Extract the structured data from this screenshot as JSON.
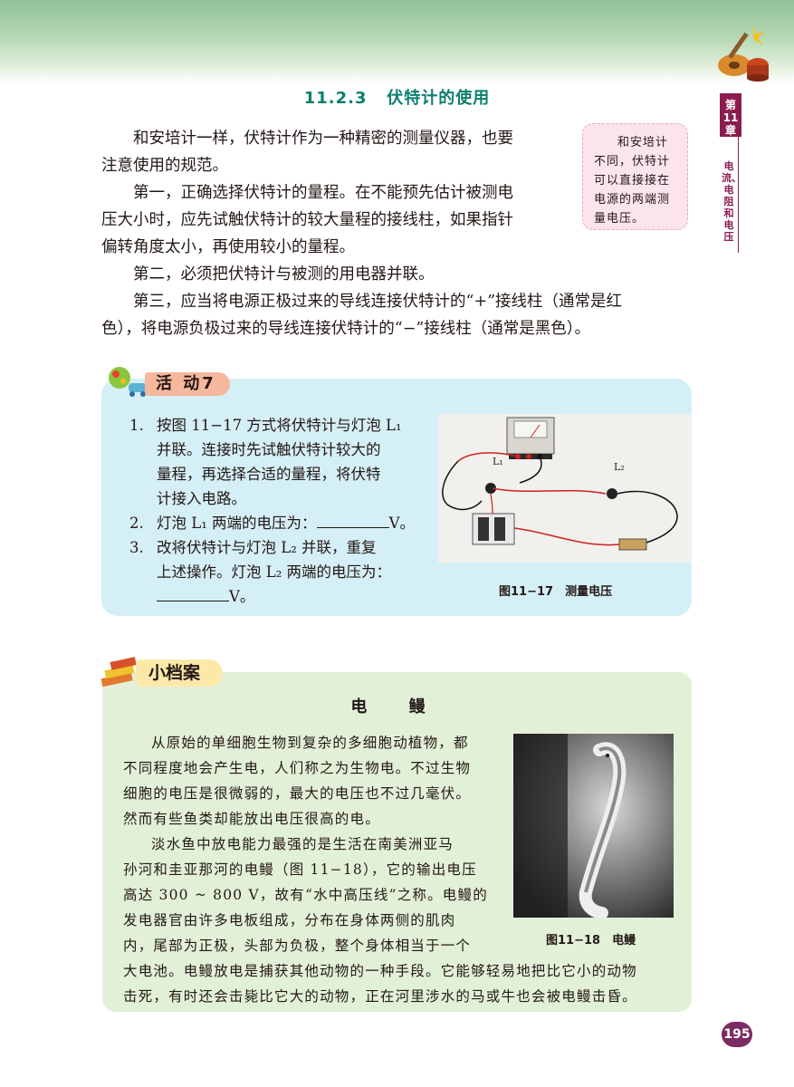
{
  "section": {
    "number": "11.2.3",
    "title": "伏特计的使用"
  },
  "side_tab": {
    "vertical_number": "第11章",
    "chapter": "电流、电阻和电压"
  },
  "intro": {
    "p1_line1": "和安培计一样，伏特计作为一种精密的测量仪器，也要",
    "p1_line2": "注意使用的规范。",
    "p2_line1": "第一，正确选择伏特计的量程。在不能预先估计被测电",
    "p2_line2": "压大小时，应先试触伏特计的较大量程的接线柱，如果指针",
    "p2_line3": "偏转角度太小，再使用较小的量程。",
    "p3": "第二，必须把伏特计与被测的用电器并联。",
    "p4_line1": "第三，应当将电源正极过来的导线连接伏特计的“+”接线柱（通常是红",
    "p4_line2": "色），将电源负极过来的导线连接伏特计的“−”接线柱（通常是黑色）。"
  },
  "margin_note": [
    "和安培计",
    "不同，伏特计",
    "可以直接接在",
    "电源的两端测",
    "量电压。"
  ],
  "activity": {
    "label": "活 动7",
    "items": [
      {
        "num": "1.",
        "lines": [
          "按图 11−17 方式将伏特计与灯泡 L₁",
          "并联。连接时先试触伏特计较大的",
          "量程，再选择合适的量程，将伏特",
          "计接入电路。"
        ]
      },
      {
        "num": "2.",
        "before": "灯泡 L₁ 两端的电压为：",
        "after": "V。"
      },
      {
        "num": "3.",
        "lines": [
          "改将伏特计与灯泡 L₂ 并联，重复",
          "上述操作。灯泡 L₂ 两端的电压为："
        ],
        "after": "V。"
      }
    ],
    "photo_labels": {
      "l1": "L₁",
      "l2": "L₂"
    },
    "caption": "图11−17　测量电压"
  },
  "file": {
    "label": "小档案",
    "title": "电 鳗",
    "lines": [
      "从原始的单细胞生物到复杂的多细胞动植物，都",
      "不同程度地会产生电，人们称之为生物电。不过生物",
      "细胞的电压是很微弱的，最大的电压也不过几毫伏。",
      "然而有些鱼类却能放出电压很高的电。",
      "淡水鱼中放电能力最强的是生活在南美洲亚马",
      "孙河和圭亚那河的电鳗（图 11−18），它的输出电压",
      "高达 300 ~ 800 V，故有“水中高压线”之称。电鳗的",
      "发电器官由许多电板组成，分布在身体两侧的肌肉",
      "内，尾部为正极，头部为负极，整个身体相当于一个"
    ],
    "full_lines": [
      "大电池。电鳗放电是捕获其他动物的一种手段。它能够轻易地把比它小的动物",
      "击死，有时还会击毙比它大的动物，正在河里涉水的马或牛也会被电鳗击昏。"
    ],
    "caption": "图11−18　电鳗"
  },
  "page_number": "195"
}
